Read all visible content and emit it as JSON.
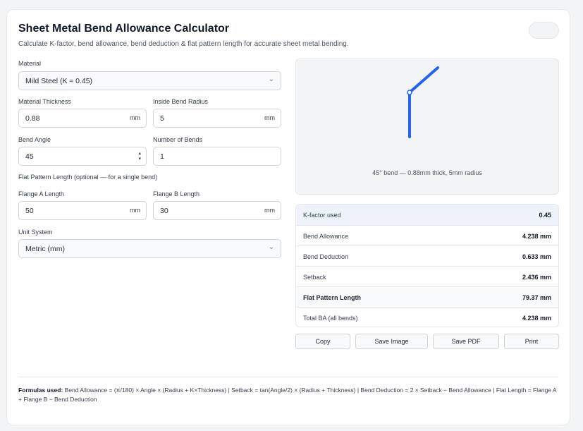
{
  "header": {
    "title": "Sheet Metal Bend Allowance Calculator",
    "subtitle": "Calculate K-factor, bend allowance, bend deduction & flat pattern length for accurate sheet metal bending."
  },
  "form": {
    "material_label": "Material",
    "material_value": "Mild Steel (K ≈ 0.45)",
    "thickness_label": "Material Thickness",
    "thickness_value": "0.88",
    "thickness_unit": "mm",
    "radius_label": "Inside Bend Radius",
    "radius_value": "5",
    "radius_unit": "mm",
    "angle_label": "Bend Angle",
    "angle_value": "45",
    "bends_label": "Number of Bends",
    "bends_value": "1",
    "flat_section_label": "Flat Pattern Length (optional — for a single bend)",
    "flange_a_label": "Flange A Length",
    "flange_a_value": "50",
    "flange_a_unit": "mm",
    "flange_b_label": "Flange B Length",
    "flange_b_value": "30",
    "flange_b_unit": "mm",
    "unit_label": "Unit System",
    "unit_value": "Metric (mm)"
  },
  "preview": {
    "caption": "45° bend — 0.88mm thick, 5mm radius",
    "stroke_color": "#2563eb"
  },
  "results": [
    {
      "label": "K-factor used",
      "value": "0.45"
    },
    {
      "label": "Bend Allowance",
      "value": "4.238 mm"
    },
    {
      "label": "Bend Deduction",
      "value": "0.633 mm"
    },
    {
      "label": "Setback",
      "value": "2.436 mm"
    },
    {
      "label": "Flat Pattern Length",
      "value": "79.37 mm"
    },
    {
      "label": "Total BA (all bends)",
      "value": "4.238 mm"
    }
  ],
  "actions": {
    "copy": "Copy",
    "save_image": "Save Image",
    "save_pdf": "Save PDF",
    "print": "Print"
  },
  "footer": {
    "formulas_label": "Formulas used:",
    "formulas_text": " Bend Allowance = (π/180) × Angle × (Radius + K×Thickness) | Setback = tan(Angle/2) × (Radius + Thickness) | Bend Deduction = 2 × Setback − Bend Allowance | Flat Length = Flange A + Flange B − Bend Deduction"
  },
  "icons": {
    "select_chevron": "chevron-down-icon",
    "number_spinner": "spinner-icon"
  }
}
